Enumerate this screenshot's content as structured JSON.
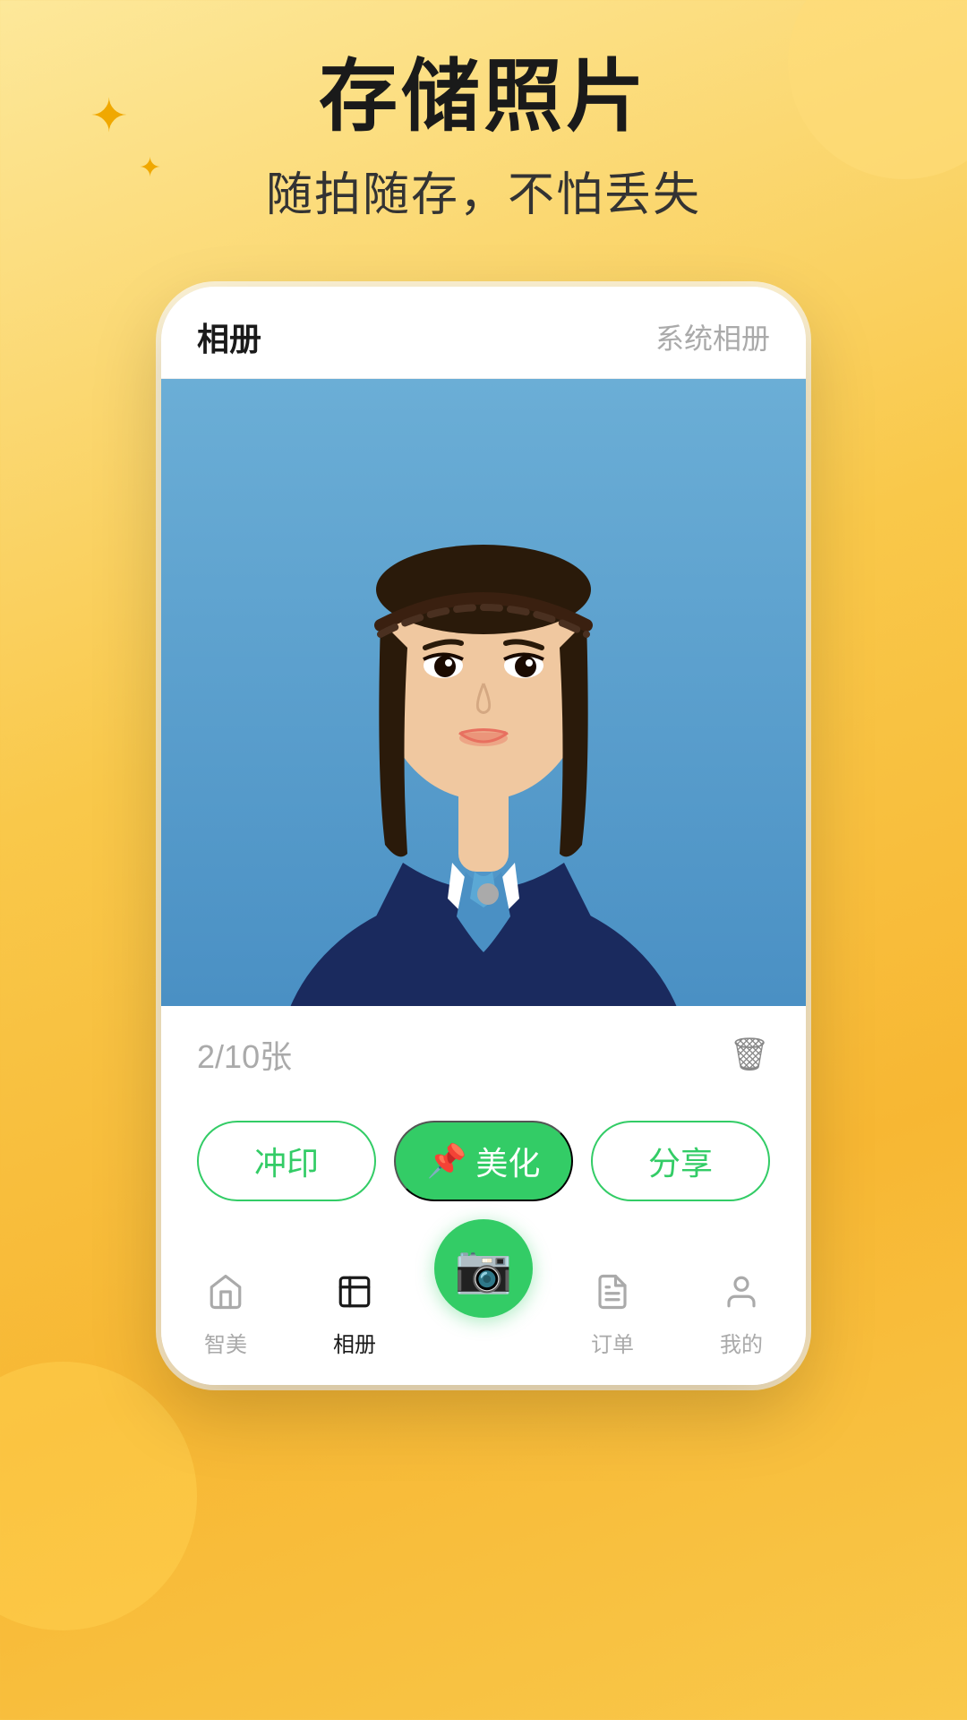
{
  "background": {
    "color_start": "#fde89a",
    "color_end": "#f7b733"
  },
  "header": {
    "main_title": "存储照片",
    "sub_title": "随拍随存，不怕丢失"
  },
  "phone": {
    "tabs": {
      "active": "相册",
      "inactive": "系统相册"
    },
    "photo": {
      "current": "2",
      "total": "10",
      "unit": "张"
    },
    "buttons": {
      "print": "冲印",
      "beautify": "美化",
      "share": "分享"
    }
  },
  "bottom_nav": {
    "items": [
      {
        "label": "智美",
        "icon": "🏠",
        "active": false
      },
      {
        "label": "相册",
        "icon": "🖼",
        "active": true
      },
      {
        "label": "",
        "icon": "📷",
        "active": false,
        "is_fab": true
      },
      {
        "label": "订单",
        "icon": "📋",
        "active": false
      },
      {
        "label": "我的",
        "icon": "👤",
        "active": false
      }
    ]
  },
  "stars": {
    "large": "✦",
    "small": "✦"
  },
  "delete_icon": "🗑",
  "pin_icon": "📌"
}
